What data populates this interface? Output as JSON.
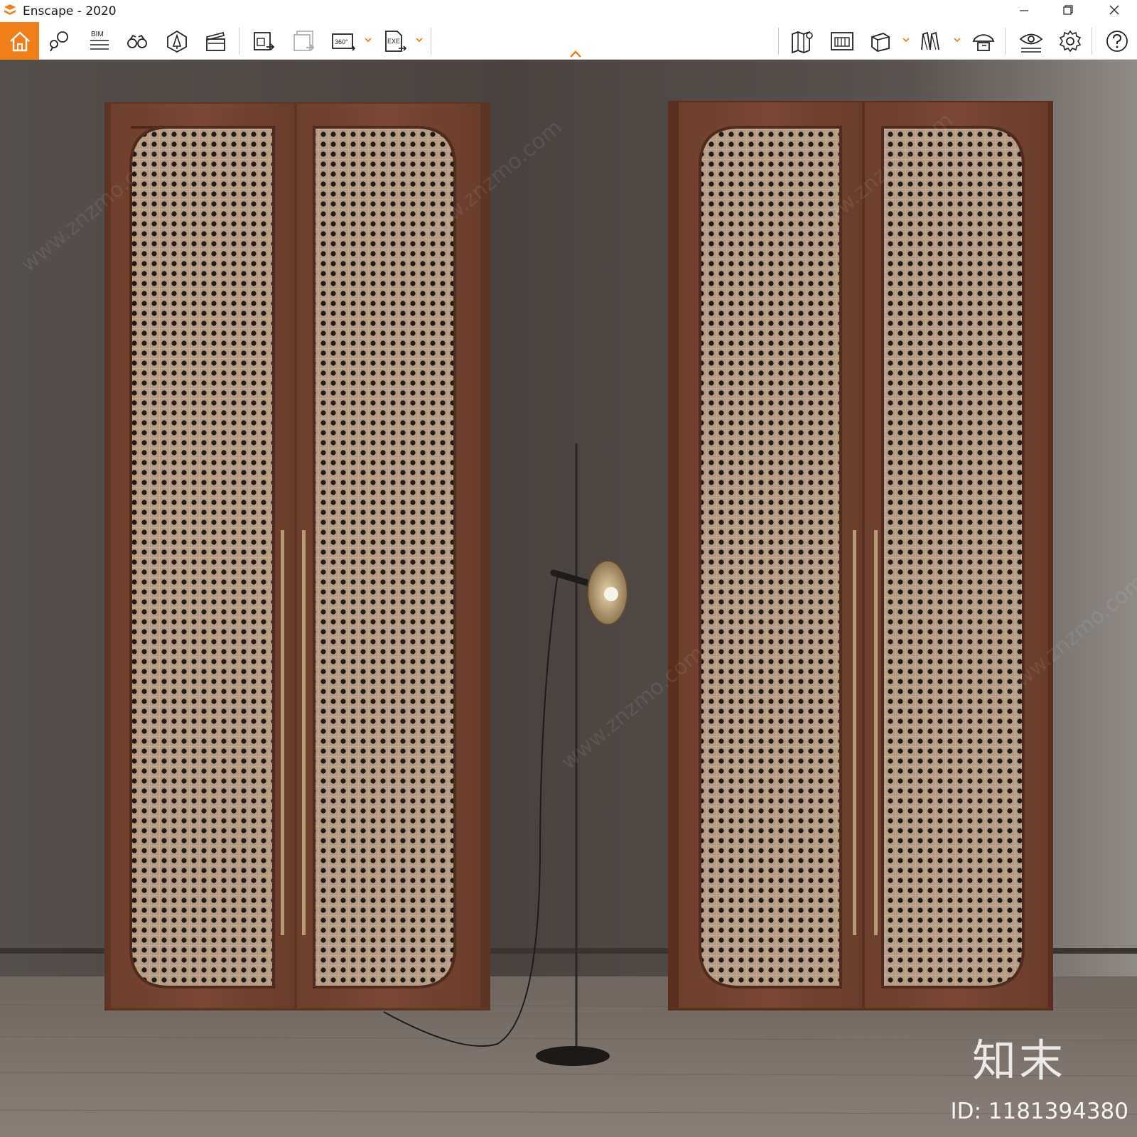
{
  "window": {
    "title": "Enscape - 2020",
    "controls": {
      "minimize": "minimize-icon",
      "restore": "restore-icon",
      "close": "close-icon"
    }
  },
  "toolbar": {
    "accent_color": "#f07f1a",
    "left_tools": [
      {
        "id": "home",
        "icon": "home-icon",
        "active": true
      },
      {
        "id": "views",
        "icon": "map-pin-icon"
      },
      {
        "id": "bim",
        "label": "BIM",
        "icon": "bim-list-icon"
      },
      {
        "id": "binoculars",
        "icon": "binoculars-icon"
      },
      {
        "id": "asset-library",
        "icon": "asset-library-icon"
      },
      {
        "id": "video-editor",
        "icon": "clapperboard-icon"
      },
      {
        "id": "screenshot",
        "icon": "render-export-icon"
      },
      {
        "id": "batch-render",
        "icon": "batch-render-icon",
        "disabled": true
      },
      {
        "id": "panorama",
        "label": "360°",
        "icon": "panorama-icon",
        "dropdown": true
      },
      {
        "id": "exe-export",
        "label": "EXE",
        "icon": "export-icon",
        "dropdown": true
      }
    ],
    "right_tools": [
      {
        "id": "map",
        "icon": "map-icon"
      },
      {
        "id": "minimap",
        "icon": "minimap-icon"
      },
      {
        "id": "view-mode",
        "icon": "cube-icon",
        "dropdown": true
      },
      {
        "id": "vr",
        "icon": "vr-icon",
        "dropdown": true
      },
      {
        "id": "collaborate",
        "icon": "hat-icon"
      },
      {
        "id": "visual-settings",
        "icon": "eye-settings-icon"
      },
      {
        "id": "settings",
        "icon": "gear-icon"
      },
      {
        "id": "help",
        "icon": "help-icon"
      }
    ],
    "collapse_icon": "chevron-up-icon"
  },
  "viewport": {
    "description_icon": "rendered-scene",
    "watermark": {
      "logo": "知末",
      "id_text": "ID: 1181394380"
    }
  }
}
